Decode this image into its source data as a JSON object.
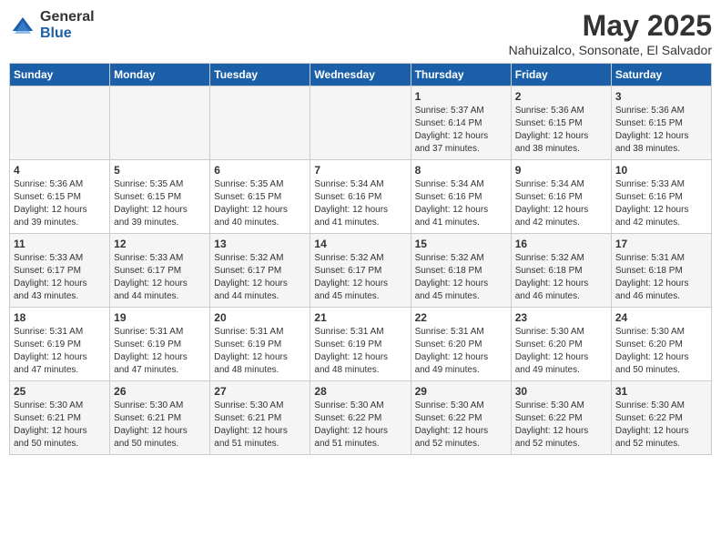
{
  "logo": {
    "general": "General",
    "blue": "Blue"
  },
  "title": "May 2025",
  "subtitle": "Nahuizalco, Sonsonate, El Salvador",
  "days_of_week": [
    "Sunday",
    "Monday",
    "Tuesday",
    "Wednesday",
    "Thursday",
    "Friday",
    "Saturday"
  ],
  "weeks": [
    [
      {
        "day": "",
        "info": ""
      },
      {
        "day": "",
        "info": ""
      },
      {
        "day": "",
        "info": ""
      },
      {
        "day": "",
        "info": ""
      },
      {
        "day": "1",
        "info": "Sunrise: 5:37 AM\nSunset: 6:14 PM\nDaylight: 12 hours\nand 37 minutes."
      },
      {
        "day": "2",
        "info": "Sunrise: 5:36 AM\nSunset: 6:15 PM\nDaylight: 12 hours\nand 38 minutes."
      },
      {
        "day": "3",
        "info": "Sunrise: 5:36 AM\nSunset: 6:15 PM\nDaylight: 12 hours\nand 38 minutes."
      }
    ],
    [
      {
        "day": "4",
        "info": "Sunrise: 5:36 AM\nSunset: 6:15 PM\nDaylight: 12 hours\nand 39 minutes."
      },
      {
        "day": "5",
        "info": "Sunrise: 5:35 AM\nSunset: 6:15 PM\nDaylight: 12 hours\nand 39 minutes."
      },
      {
        "day": "6",
        "info": "Sunrise: 5:35 AM\nSunset: 6:15 PM\nDaylight: 12 hours\nand 40 minutes."
      },
      {
        "day": "7",
        "info": "Sunrise: 5:34 AM\nSunset: 6:16 PM\nDaylight: 12 hours\nand 41 minutes."
      },
      {
        "day": "8",
        "info": "Sunrise: 5:34 AM\nSunset: 6:16 PM\nDaylight: 12 hours\nand 41 minutes."
      },
      {
        "day": "9",
        "info": "Sunrise: 5:34 AM\nSunset: 6:16 PM\nDaylight: 12 hours\nand 42 minutes."
      },
      {
        "day": "10",
        "info": "Sunrise: 5:33 AM\nSunset: 6:16 PM\nDaylight: 12 hours\nand 42 minutes."
      }
    ],
    [
      {
        "day": "11",
        "info": "Sunrise: 5:33 AM\nSunset: 6:17 PM\nDaylight: 12 hours\nand 43 minutes."
      },
      {
        "day": "12",
        "info": "Sunrise: 5:33 AM\nSunset: 6:17 PM\nDaylight: 12 hours\nand 44 minutes."
      },
      {
        "day": "13",
        "info": "Sunrise: 5:32 AM\nSunset: 6:17 PM\nDaylight: 12 hours\nand 44 minutes."
      },
      {
        "day": "14",
        "info": "Sunrise: 5:32 AM\nSunset: 6:17 PM\nDaylight: 12 hours\nand 45 minutes."
      },
      {
        "day": "15",
        "info": "Sunrise: 5:32 AM\nSunset: 6:18 PM\nDaylight: 12 hours\nand 45 minutes."
      },
      {
        "day": "16",
        "info": "Sunrise: 5:32 AM\nSunset: 6:18 PM\nDaylight: 12 hours\nand 46 minutes."
      },
      {
        "day": "17",
        "info": "Sunrise: 5:31 AM\nSunset: 6:18 PM\nDaylight: 12 hours\nand 46 minutes."
      }
    ],
    [
      {
        "day": "18",
        "info": "Sunrise: 5:31 AM\nSunset: 6:19 PM\nDaylight: 12 hours\nand 47 minutes."
      },
      {
        "day": "19",
        "info": "Sunrise: 5:31 AM\nSunset: 6:19 PM\nDaylight: 12 hours\nand 47 minutes."
      },
      {
        "day": "20",
        "info": "Sunrise: 5:31 AM\nSunset: 6:19 PM\nDaylight: 12 hours\nand 48 minutes."
      },
      {
        "day": "21",
        "info": "Sunrise: 5:31 AM\nSunset: 6:19 PM\nDaylight: 12 hours\nand 48 minutes."
      },
      {
        "day": "22",
        "info": "Sunrise: 5:31 AM\nSunset: 6:20 PM\nDaylight: 12 hours\nand 49 minutes."
      },
      {
        "day": "23",
        "info": "Sunrise: 5:30 AM\nSunset: 6:20 PM\nDaylight: 12 hours\nand 49 minutes."
      },
      {
        "day": "24",
        "info": "Sunrise: 5:30 AM\nSunset: 6:20 PM\nDaylight: 12 hours\nand 50 minutes."
      }
    ],
    [
      {
        "day": "25",
        "info": "Sunrise: 5:30 AM\nSunset: 6:21 PM\nDaylight: 12 hours\nand 50 minutes."
      },
      {
        "day": "26",
        "info": "Sunrise: 5:30 AM\nSunset: 6:21 PM\nDaylight: 12 hours\nand 50 minutes."
      },
      {
        "day": "27",
        "info": "Sunrise: 5:30 AM\nSunset: 6:21 PM\nDaylight: 12 hours\nand 51 minutes."
      },
      {
        "day": "28",
        "info": "Sunrise: 5:30 AM\nSunset: 6:22 PM\nDaylight: 12 hours\nand 51 minutes."
      },
      {
        "day": "29",
        "info": "Sunrise: 5:30 AM\nSunset: 6:22 PM\nDaylight: 12 hours\nand 52 minutes."
      },
      {
        "day": "30",
        "info": "Sunrise: 5:30 AM\nSunset: 6:22 PM\nDaylight: 12 hours\nand 52 minutes."
      },
      {
        "day": "31",
        "info": "Sunrise: 5:30 AM\nSunset: 6:22 PM\nDaylight: 12 hours\nand 52 minutes."
      }
    ]
  ]
}
